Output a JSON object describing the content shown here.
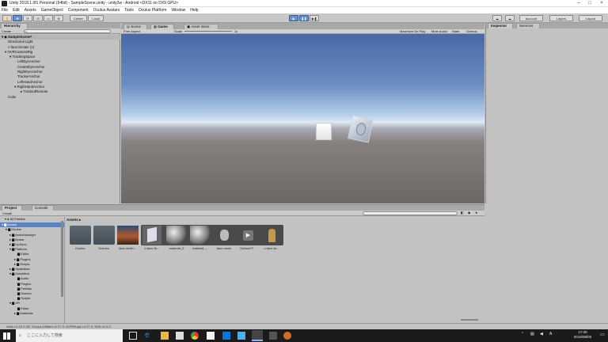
{
  "window": {
    "title": "Unity 2018.1.0f1 Personal (64bit) - SampleScene.unity - unity2w - Android <DX11 on DX9 GPU>"
  },
  "menu": [
    "File",
    "Edit",
    "Assets",
    "GameObject",
    "Component",
    "Oculus Avatars",
    "Tools",
    "Oculus Platform",
    "Window",
    "Help"
  ],
  "toolbar": {
    "pivot": "Center",
    "space": "Local",
    "account": "Account",
    "layers": "Layers",
    "layout": "Layout"
  },
  "hierarchy": {
    "tab": "Hierarchy",
    "create": "Create",
    "search_placeholder": "All",
    "items": [
      "SampleScene*",
      "Directional Light",
      "c-face-female (1)",
      "OVRCameraRig",
      "TrackingSpace",
      "LeftEyeAnchor",
      "CenterEyeAnchor",
      "RightEyeAnchor",
      "TrackerAnchor",
      "LeftHandAnchor",
      "RightHandAnchor",
      "TrackedRemote",
      "Cube"
    ]
  },
  "scene_tabs": {
    "scene": "Scene",
    "game": "Game",
    "asset_store": "Asset Store"
  },
  "game_bar": {
    "aspect": "Free Aspect",
    "scale_label": "Scale",
    "scale_value": "1x",
    "maximize": "Maximize On Play",
    "mute": "Mute Audio",
    "stats": "Stats",
    "gizmos": "Gizmos"
  },
  "inspector": {
    "tab": "Inspector",
    "services": "Services"
  },
  "project": {
    "tab": "Project",
    "console": "Console",
    "create": "Create",
    "favorites": "All Prefabs",
    "breadcrumb": "Assets",
    "tree": [
      "Assets",
      "Oculus",
      "AudioManager",
      "Avatar",
      "LipSync",
      "Platform",
      "Editor",
      "Plugins",
      "Scripts",
      "Spatializer",
      "VoiceMod",
      "Audio",
      "Plugins",
      "Prefabs",
      "Scenes",
      "Scripts",
      "VR",
      "Editor",
      "Materials"
    ],
    "assets": [
      "Oculus",
      "Scenes",
      "face-mesh...",
      "c-face-fe...",
      "material_0",
      "material_...",
      "face-mesh",
      "Default P...",
      "c-face-fe..."
    ]
  },
  "status": {
    "text": "Unity v1.25.2.2f1, Oculus Utilities v1.27.0, OVRPlugin v1.27.0, SDK v1.0.0."
  },
  "taskbar": {
    "search": "ここに入力して検索",
    "time": "17:30",
    "date": "2018/08/02"
  }
}
